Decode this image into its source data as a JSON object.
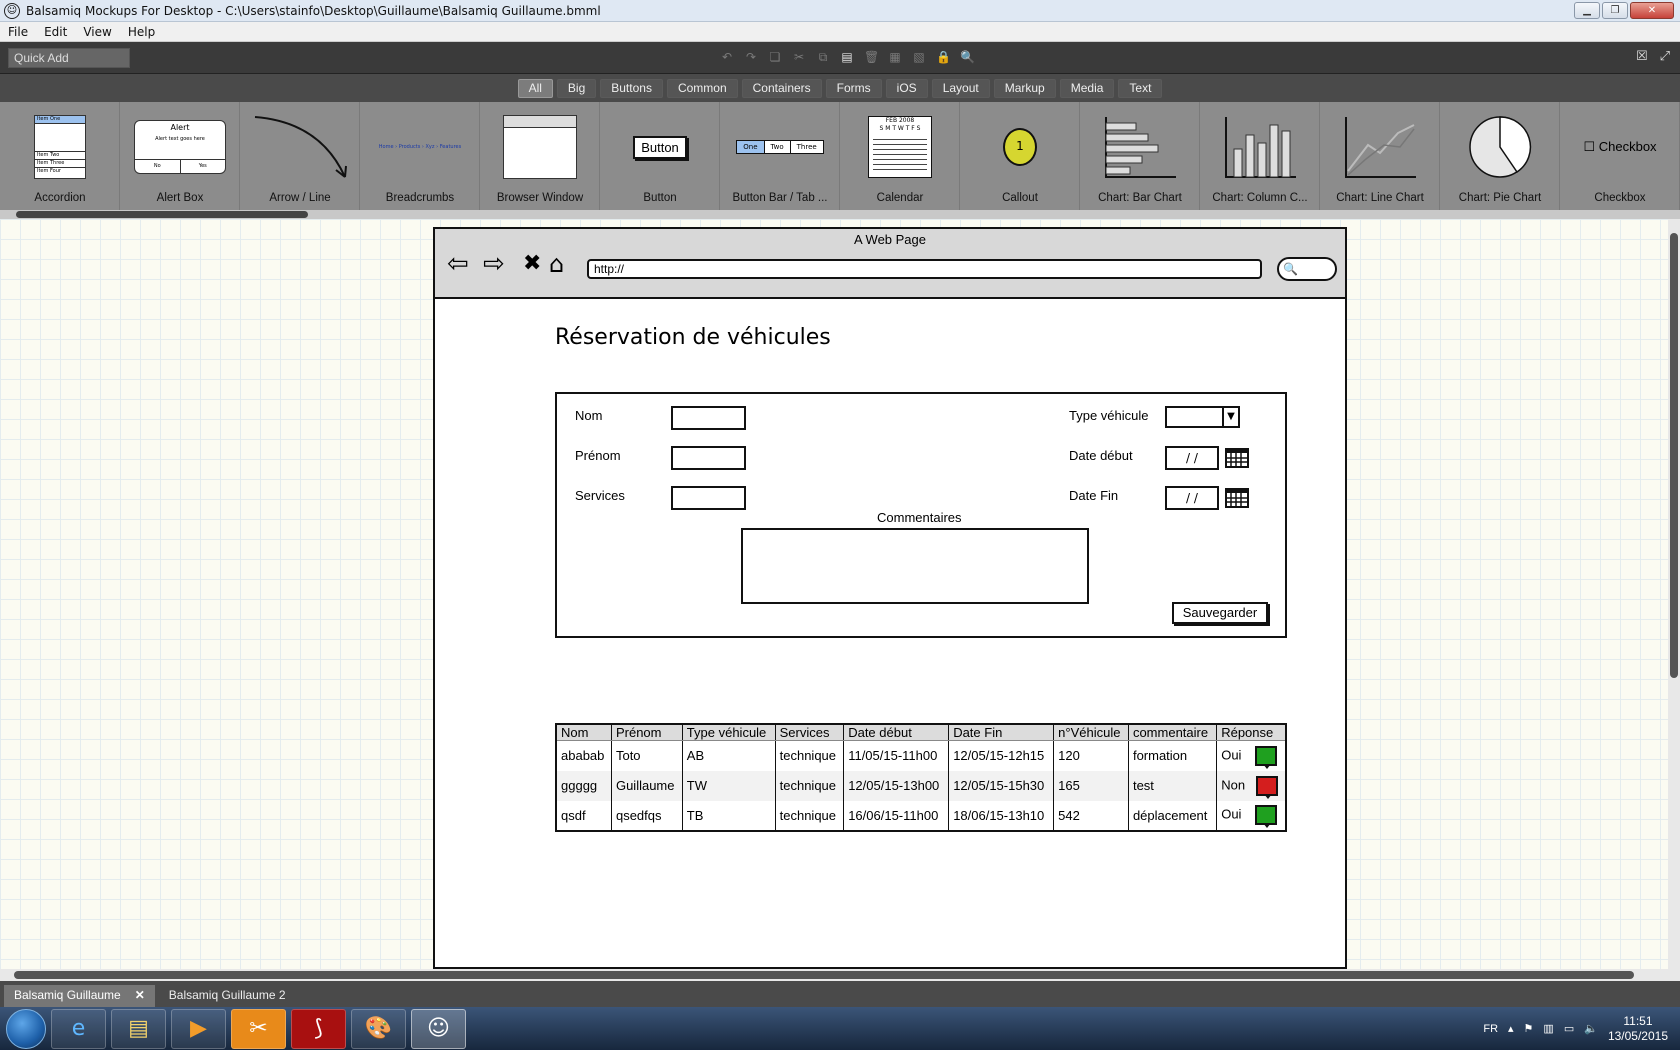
{
  "window": {
    "title": "Balsamiq Mockups For Desktop - C:\\Users\\stainfo\\Desktop\\Guillaume\\Balsamiq Guillaume.bmml",
    "minimize_icon": "minimize-icon",
    "maximize_icon": "maximize-icon",
    "close_icon": "close-icon"
  },
  "menu": [
    "File",
    "Edit",
    "View",
    "Help"
  ],
  "toolbar": {
    "quick_add_placeholder": "Quick Add",
    "icons": [
      "undo-icon",
      "redo-icon",
      "copy-icon",
      "cut-icon",
      "duplicate-icon",
      "paste-icon",
      "delete-icon",
      "group-icon",
      "ungroup-icon",
      "lock-icon",
      "search-icon"
    ]
  },
  "categories": {
    "active": "All",
    "items": [
      "All",
      "Big",
      "Buttons",
      "Common",
      "Containers",
      "Forms",
      "iOS",
      "Layout",
      "Markup",
      "Media",
      "Text"
    ]
  },
  "library": [
    {
      "label": "Accordion",
      "icon": "accordion-icon",
      "item_one": "Item One",
      "item_two": "Item Two",
      "item_three": "Item Three",
      "item_four": "Item Four"
    },
    {
      "label": "Alert Box",
      "icon": "alert-box-icon",
      "alert_title": "Alert",
      "alert_text": "Alert text goes here",
      "no": "No",
      "yes": "Yes"
    },
    {
      "label": "Arrow / Line",
      "icon": "arrow-line-icon"
    },
    {
      "label": "Breadcrumbs",
      "icon": "breadcrumbs-icon",
      "crumbs": "Home › Products › Xyz › Features"
    },
    {
      "label": "Browser Window",
      "icon": "browser-window-icon"
    },
    {
      "label": "Button",
      "icon": "button-icon",
      "button_text": "Button"
    },
    {
      "label": "Button Bar / Tab ...",
      "icon": "button-bar-icon",
      "one": "One",
      "two": "Two",
      "three": "Three"
    },
    {
      "label": "Calendar",
      "icon": "calendar-icon",
      "month": "FEB 2008",
      "days": "S M T W T F S"
    },
    {
      "label": "Callout",
      "icon": "callout-icon",
      "number": "1"
    },
    {
      "label": "Chart: Bar Chart",
      "icon": "bar-chart-icon"
    },
    {
      "label": "Chart: Column C...",
      "icon": "column-chart-icon"
    },
    {
      "label": "Chart: Line Chart",
      "icon": "line-chart-icon"
    },
    {
      "label": "Chart: Pie Chart",
      "icon": "pie-chart-icon"
    },
    {
      "label": "Checkbox",
      "icon": "checkbox-icon",
      "checkbox_text": "Checkbox"
    }
  ],
  "mockup": {
    "browser_title": "A Web Page",
    "url": "http://",
    "nav_icons": [
      "back-arrow-icon",
      "forward-arrow-icon",
      "stop-x-icon",
      "home-icon",
      "search-icon"
    ],
    "page_title": "Réservation de véhicules",
    "form": {
      "nom": "Nom",
      "prenom": "Prénom",
      "services": "Services",
      "type_vehicule": "Type véhicule",
      "date_debut": "Date début",
      "date_fin": "Date Fin",
      "date_placeholder": "/ /",
      "commentaires": "Commentaires",
      "save": "Sauvegarder"
    },
    "table": {
      "headers": [
        "Nom",
        "Prénom",
        "Type véhicule",
        "Services",
        "Date début",
        "Date Fin",
        "n°Véhicule",
        "commentaire",
        "Réponse"
      ],
      "rows": [
        {
          "nom": "ababab",
          "prenom": "Toto",
          "type": "AB",
          "services": "technique",
          "debut": "11/05/15-11h00",
          "fin": "12/05/15-12h15",
          "num": "120",
          "commentaire": "formation",
          "reponse": "Oui",
          "color": "#1fa01f"
        },
        {
          "nom": "ggggg",
          "prenom": "Guillaume",
          "type": "TW",
          "services": "technique",
          "debut": "12/05/15-13h00",
          "fin": "12/05/15-15h30",
          "num": "165",
          "commentaire": "test",
          "reponse": "Non",
          "color": "#d41e1e"
        },
        {
          "nom": "qsdf",
          "prenom": "qsedfqs",
          "type": "TB",
          "services": "technique",
          "debut": "16/06/15-11h00",
          "fin": "18/06/15-13h10",
          "num": "542",
          "commentaire": "déplacement",
          "reponse": "Oui",
          "color": "#1fa01f"
        }
      ]
    }
  },
  "file_tabs": [
    {
      "label": "Balsamiq Guillaume",
      "active": true
    },
    {
      "label": "Balsamiq Guillaume 2",
      "active": false
    }
  ],
  "taskbar": {
    "apps": [
      "internet-explorer-icon",
      "file-explorer-icon",
      "media-player-icon",
      "snipping-tool-icon",
      "acrobat-reader-icon",
      "paint-icon",
      "balsamiq-icon"
    ],
    "language": "FR",
    "time": "11:51",
    "date": "13/05/2015"
  }
}
